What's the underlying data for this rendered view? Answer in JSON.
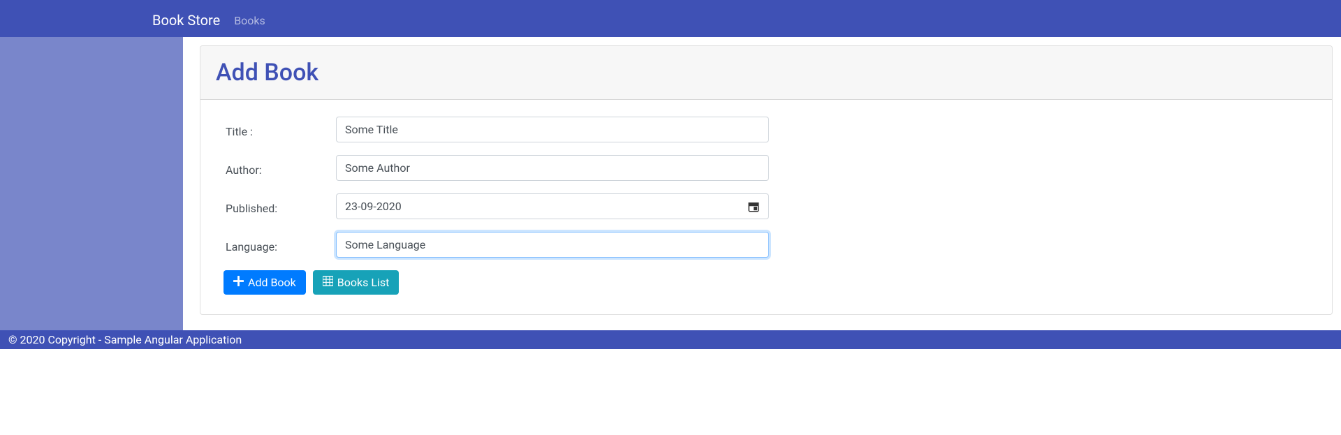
{
  "navbar": {
    "brand": "Book Store",
    "link_books": "Books"
  },
  "page": {
    "title": "Add Book"
  },
  "form": {
    "title_label": "Title :",
    "title_value": "Some Title",
    "author_label": "Author:",
    "author_value": "Some Author",
    "published_label": "Published:",
    "published_value": "23-09-2020",
    "language_label": "Language:",
    "language_value": "Some Language"
  },
  "buttons": {
    "add_book": "Add Book",
    "books_list": "Books List"
  },
  "footer": {
    "copyright": "© 2020 Copyright - Sample Angular Application"
  }
}
